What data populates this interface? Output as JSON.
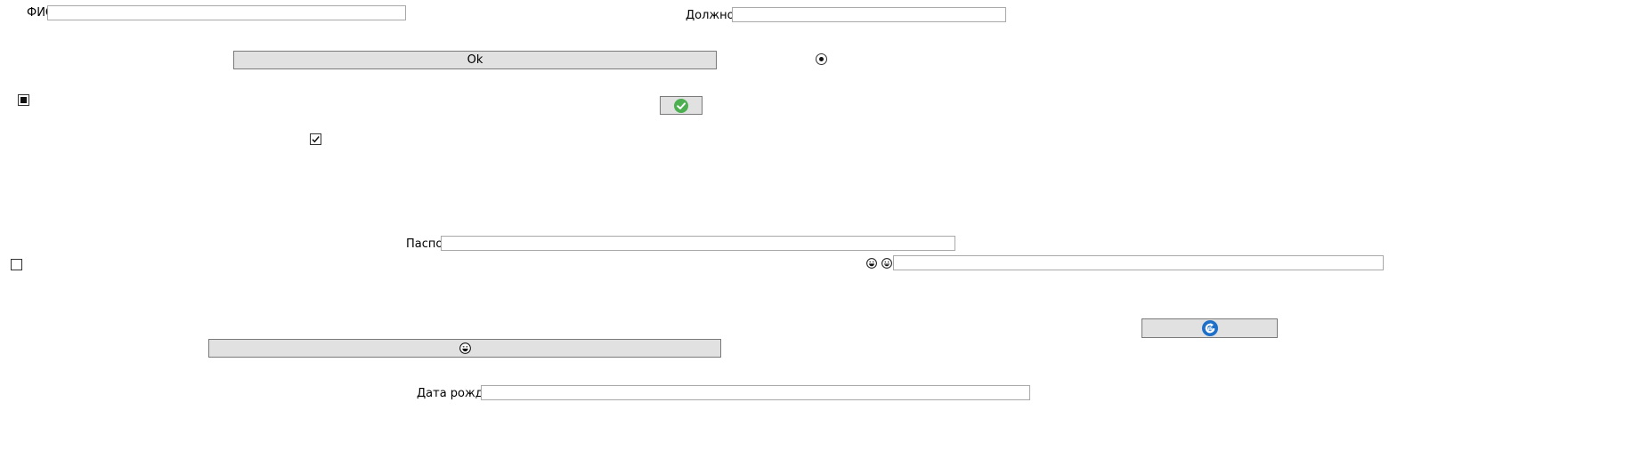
{
  "fields": {
    "fio": {
      "label": "ФИО",
      "value": ""
    },
    "position": {
      "label": "Должность",
      "value": ""
    },
    "passport": {
      "label": "Паспорт",
      "value": ""
    },
    "birth_date": {
      "label": "Дата рождения",
      "value": ""
    },
    "emoji_field": {
      "value": ""
    }
  },
  "buttons": {
    "ok_label": "Ok"
  },
  "states": {
    "radio_selected": true,
    "checkbox_top_left": "indeterminate",
    "checkbox_middle": "checked",
    "checkbox_bottom_left": "unchecked"
  },
  "icons": {
    "confirm": "check-circle-icon",
    "refresh": "refresh-circle-icon",
    "emoji_button": "grinning-face-icon",
    "emoji_label_1": "grinning-face-icon",
    "emoji_label_2": "smiling-face-icon"
  },
  "colors": {
    "confirm_green": "#4caf50",
    "refresh_blue": "#1e6fc8",
    "button_face": "#e1e1e1"
  }
}
